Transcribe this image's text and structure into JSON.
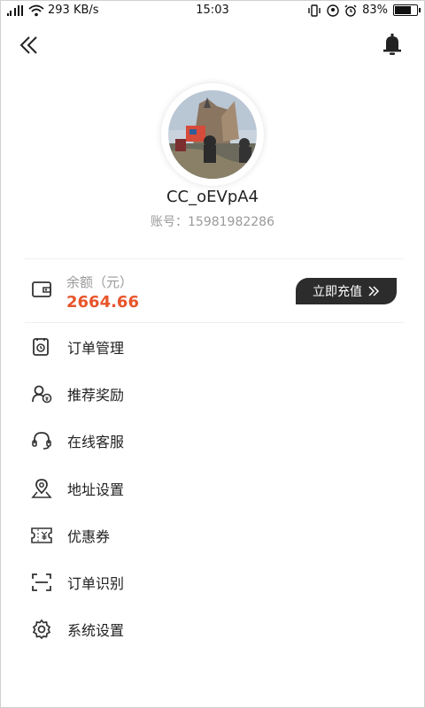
{
  "status_bar": {
    "network_speed": "293 KB/s",
    "time": "15:03",
    "battery": "83%",
    "battery_level": 0.83
  },
  "header": {
    "back_icon": "double-chevron-left-icon",
    "notification_icon": "bell-icon"
  },
  "profile": {
    "username": "CC_oEVpA4",
    "account": "账号：15981982286"
  },
  "balance": {
    "label": "余额（元）",
    "value": "2664.66",
    "recharge_label": "立即充值",
    "recharge_icon": "double-chevron-right-icon",
    "accent_color": "#e8552b"
  },
  "menu": {
    "items": [
      {
        "label": "订单管理",
        "icon": "order-management-icon"
      },
      {
        "label": "推荐奖励",
        "icon": "referral-reward-icon"
      },
      {
        "label": "在线客服",
        "icon": "headset-icon"
      },
      {
        "label": "地址设置",
        "icon": "location-pin-icon"
      },
      {
        "label": "优惠券",
        "icon": "coupon-icon"
      },
      {
        "label": "订单识别",
        "icon": "scan-icon"
      },
      {
        "label": "系统设置",
        "icon": "gear-icon"
      }
    ]
  }
}
